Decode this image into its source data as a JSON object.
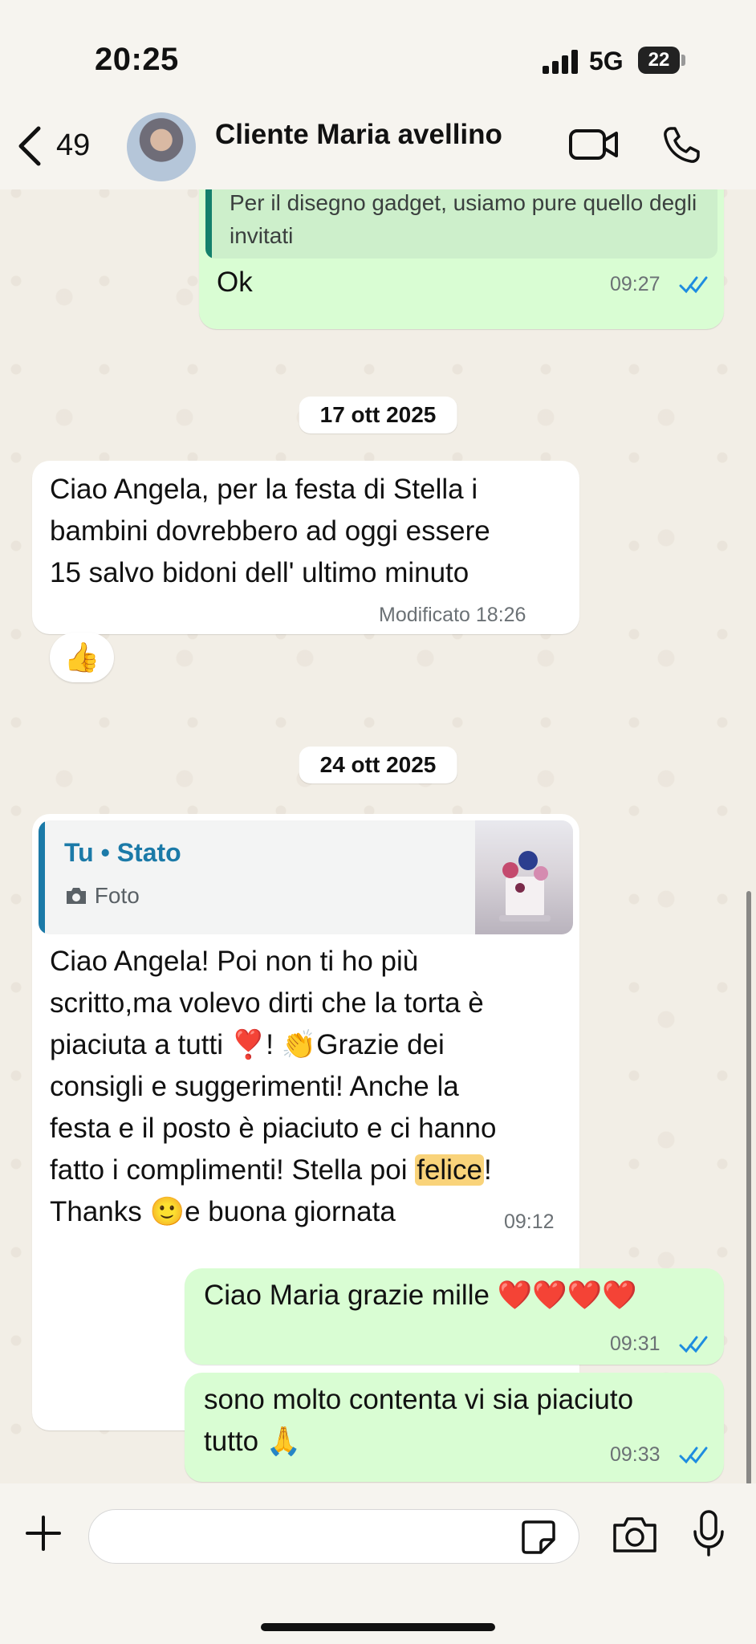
{
  "status_bar": {
    "time": "20:25",
    "network": "5G",
    "battery": "22"
  },
  "header": {
    "unread_count": "49",
    "contact_name": "Cliente Maria avellino"
  },
  "messages": {
    "m1": {
      "quote": "Per il disegno gadget, usiamo pure quello degli invitati",
      "text": "Ok",
      "time": "09:27"
    },
    "date1": "17 ott 2025",
    "m2": {
      "line1": "Ciao Angela, per la festa di Stella i",
      "line2": "bambini dovrebbero ad oggi essere",
      "line3": "15 salvo bidoni dell' ultimo minuto",
      "edited": "Modificato 18:26",
      "reaction": "👍"
    },
    "date2": "24 ott 2025",
    "m3": {
      "status_title": "Tu • Stato",
      "status_type": "Foto",
      "line1": "Ciao Angela! Poi non ti ho più",
      "line2": "scritto,ma volevo dirti che la torta è",
      "line3": "piaciuta a tutti ❣️! 👏Grazie dei",
      "line4": "consigli e suggerimenti! Anche la",
      "line5": "festa e il posto è piaciuto e ci hanno",
      "line6_a": "fatto i complimenti! Stella poi ",
      "line6_hl": "felice",
      "line6_b": "!",
      "line7": "Thanks 🙂e buona giornata",
      "time": "09:12"
    },
    "m4": {
      "text": "Ciao Maria grazie mille ❤️❤️❤️❤️",
      "time": "09:31"
    },
    "m5": {
      "line1": "sono molto contenta vi sia piaciuto",
      "line2": "tutto 🙏",
      "time": "09:33"
    }
  },
  "colors": {
    "outgoing": "#D9FDD3",
    "incoming": "#FFFFFF",
    "read_ticks": "#1E8CE0",
    "status_accent": "#1b7aa8"
  },
  "icons": [
    "back-chevron-icon",
    "video-call-icon",
    "phone-call-icon",
    "plus-icon",
    "sticker-icon",
    "camera-icon",
    "microphone-icon",
    "read-ticks-icon"
  ]
}
